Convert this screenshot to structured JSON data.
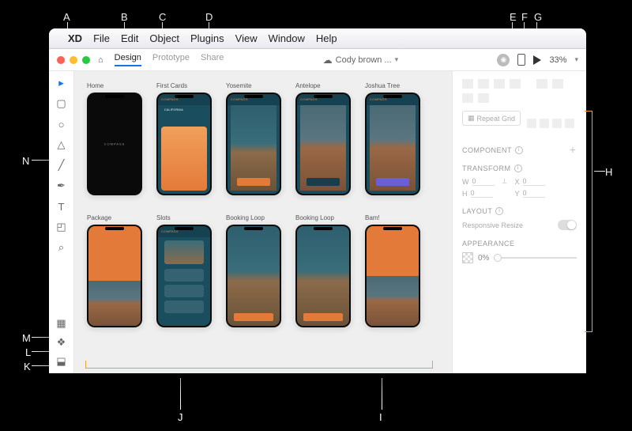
{
  "callouts": {
    "A": "A",
    "B": "B",
    "C": "C",
    "D": "D",
    "E": "E",
    "F": "F",
    "G": "G",
    "H": "H",
    "I": "I",
    "J": "J",
    "K": "K",
    "L": "L",
    "M": "M",
    "N": "N"
  },
  "menubar": {
    "xd": "XD",
    "file": "File",
    "edit": "Edit",
    "object": "Object",
    "plugins": "Plugins",
    "view": "View",
    "window": "Window",
    "help": "Help"
  },
  "toolbar": {
    "tabs": {
      "design": "Design",
      "prototype": "Prototype",
      "share": "Share"
    },
    "doc_title": "Cody brown ...",
    "zoom": "33%"
  },
  "artboards_row1": [
    {
      "name": "Home"
    },
    {
      "name": "First Cards"
    },
    {
      "name": "Yosemite"
    },
    {
      "name": "Antelope"
    },
    {
      "name": "Joshua Tree"
    }
  ],
  "artboards_row2": [
    {
      "name": "Package"
    },
    {
      "name": "Slots"
    },
    {
      "name": "Booking Loop"
    },
    {
      "name": "Booking Loop"
    },
    {
      "name": "Bam!"
    }
  ],
  "screen_text": {
    "compass": "COMPASS",
    "california": "CALIFORNIA"
  },
  "panel": {
    "repeat_grid": "Repeat Grid",
    "component": "COMPONENT",
    "transform": "TRANSFORM",
    "w": "W",
    "h": "H",
    "x": "X",
    "y": "Y",
    "w_val": "0",
    "h_val": "0",
    "x_val": "0",
    "y_val": "0",
    "layout": "LAYOUT",
    "responsive": "Responsive Resize",
    "appearance": "APPEARANCE",
    "opacity": "0%"
  }
}
